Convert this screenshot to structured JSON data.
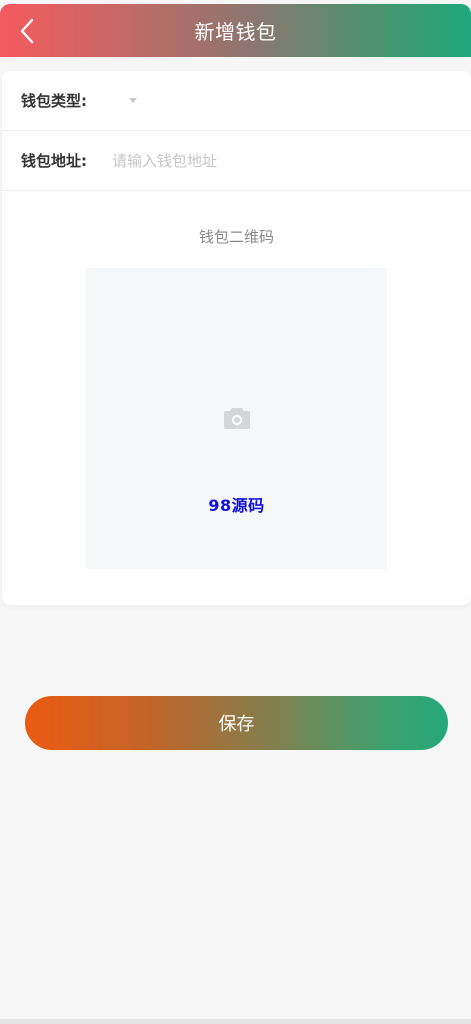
{
  "header": {
    "title": "新增钱包",
    "back_icon": "chevron-left-icon"
  },
  "form": {
    "wallet_type": {
      "label": "钱包类型:",
      "value": ""
    },
    "wallet_address": {
      "label": "钱包地址:",
      "placeholder": "请输入钱包地址",
      "value": ""
    },
    "qr_code": {
      "title": "钱包二维码",
      "upload_icon": "camera-icon",
      "watermark": "98源码"
    }
  },
  "actions": {
    "save_label": "保存"
  },
  "colors": {
    "header_gradient_start": "#f55a5f",
    "header_gradient_end": "#20a87c",
    "button_gradient_start": "#ec5a12",
    "button_gradient_end": "#25a87c",
    "watermark": "#1010e0",
    "background": "#f6f6f6"
  }
}
